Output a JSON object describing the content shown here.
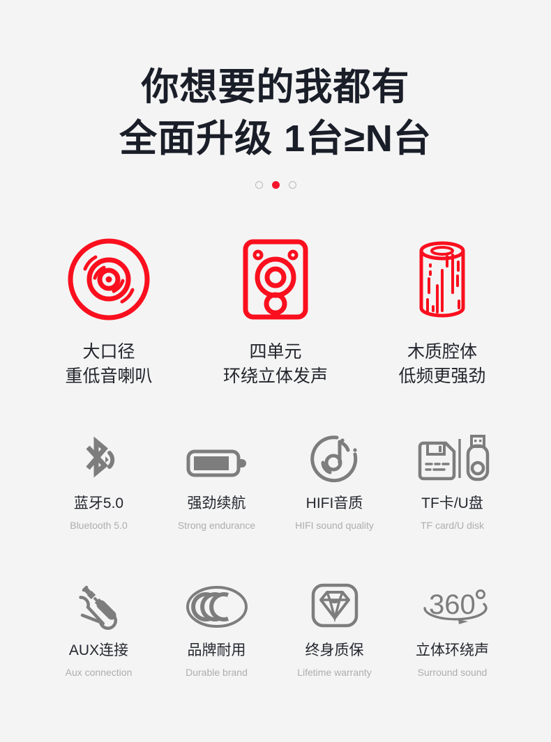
{
  "hero": {
    "line1": "你想要的我都有",
    "line2": "全面升级 1台≥N台",
    "carousel": {
      "total": 3,
      "active_index": 1
    }
  },
  "colors": {
    "background": "#f4f4f4",
    "headline": "#1a1e28",
    "accent_red": "#fa0f1e",
    "icon_gray": "#7d7d7d",
    "label_dark": "#24272e",
    "label_light": "#adadad"
  },
  "primary_features": [
    {
      "icon": "vinyl-speaker-icon",
      "label_line1": "大口径",
      "label_line2": "重低音喇叭"
    },
    {
      "icon": "speaker-cabinet-icon",
      "label_line1": "四单元",
      "label_line2": "环绕立体发声"
    },
    {
      "icon": "wood-log-icon",
      "label_line1": "木质腔体",
      "label_line2": "低频更强劲"
    }
  ],
  "secondary_features_row1": [
    {
      "icon": "bluetooth-icon",
      "label_cn": "蓝牙5.0",
      "label_en": "Bluetooth 5.0"
    },
    {
      "icon": "battery-icon",
      "label_cn": "强劲续航",
      "label_en": "Strong endurance"
    },
    {
      "icon": "music-note-icon",
      "label_cn": "HIFI音质",
      "label_en": "HIFI sound quality"
    },
    {
      "icon": "tf-card-usb-icon",
      "label_cn": "TF卡/U盘",
      "label_en": "TF card/U disk"
    }
  ],
  "secondary_features_row2": [
    {
      "icon": "aux-jack-icon",
      "label_cn": "AUX连接",
      "label_en": "Aux connection"
    },
    {
      "icon": "ccc-mark-icon",
      "label_cn": "品牌耐用",
      "label_en": "Durable brand"
    },
    {
      "icon": "diamond-icon",
      "label_cn": "终身质保",
      "label_en": "Lifetime warranty"
    },
    {
      "icon": "surround-360-icon",
      "label_cn": "立体环绕声",
      "label_en": "Surround sound"
    }
  ]
}
